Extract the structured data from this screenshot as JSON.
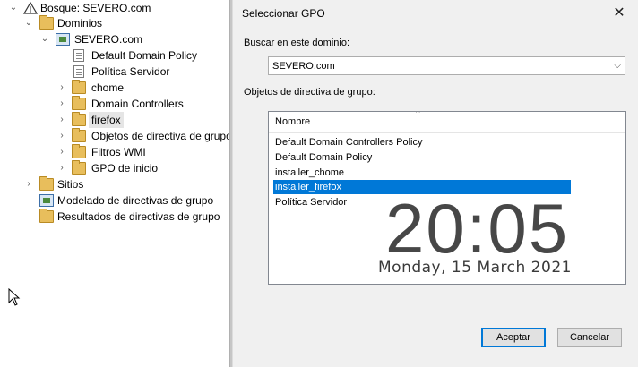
{
  "tree": {
    "forest": "Bosque: SEVERO.com",
    "domains": "Dominios",
    "domain": "SEVERO.com",
    "items": [
      "Default Domain Policy",
      "Política Servidor",
      "chome",
      "Domain Controllers",
      "firefox",
      "Objetos de directiva de grupo",
      "Filtros WMI",
      "GPO de inicio"
    ],
    "sites": "Sitios",
    "modeling": "Modelado de directivas de grupo",
    "results": "Resultados de directivas de grupo",
    "selected_item": "firefox"
  },
  "dialog": {
    "title": "Seleccionar GPO",
    "search_label": "Buscar en este dominio:",
    "domain_value": "SEVERO.com",
    "objects_label": "Objetos de directiva de grupo:",
    "column_header": "Nombre",
    "rows": [
      "Default Domain Controllers Policy",
      "Default Domain Policy",
      "installer_chome",
      "installer_firefox",
      "Política Servidor"
    ],
    "selected_row": "installer_firefox",
    "accept_label": "Aceptar",
    "cancel_label": "Cancelar"
  },
  "clock": {
    "time": "20:05",
    "date": "Monday, 15 March 2021"
  },
  "colors": {
    "selection": "#0078d7",
    "dialog_bg": "#f0f0f0",
    "folder": "#e8be5c"
  }
}
